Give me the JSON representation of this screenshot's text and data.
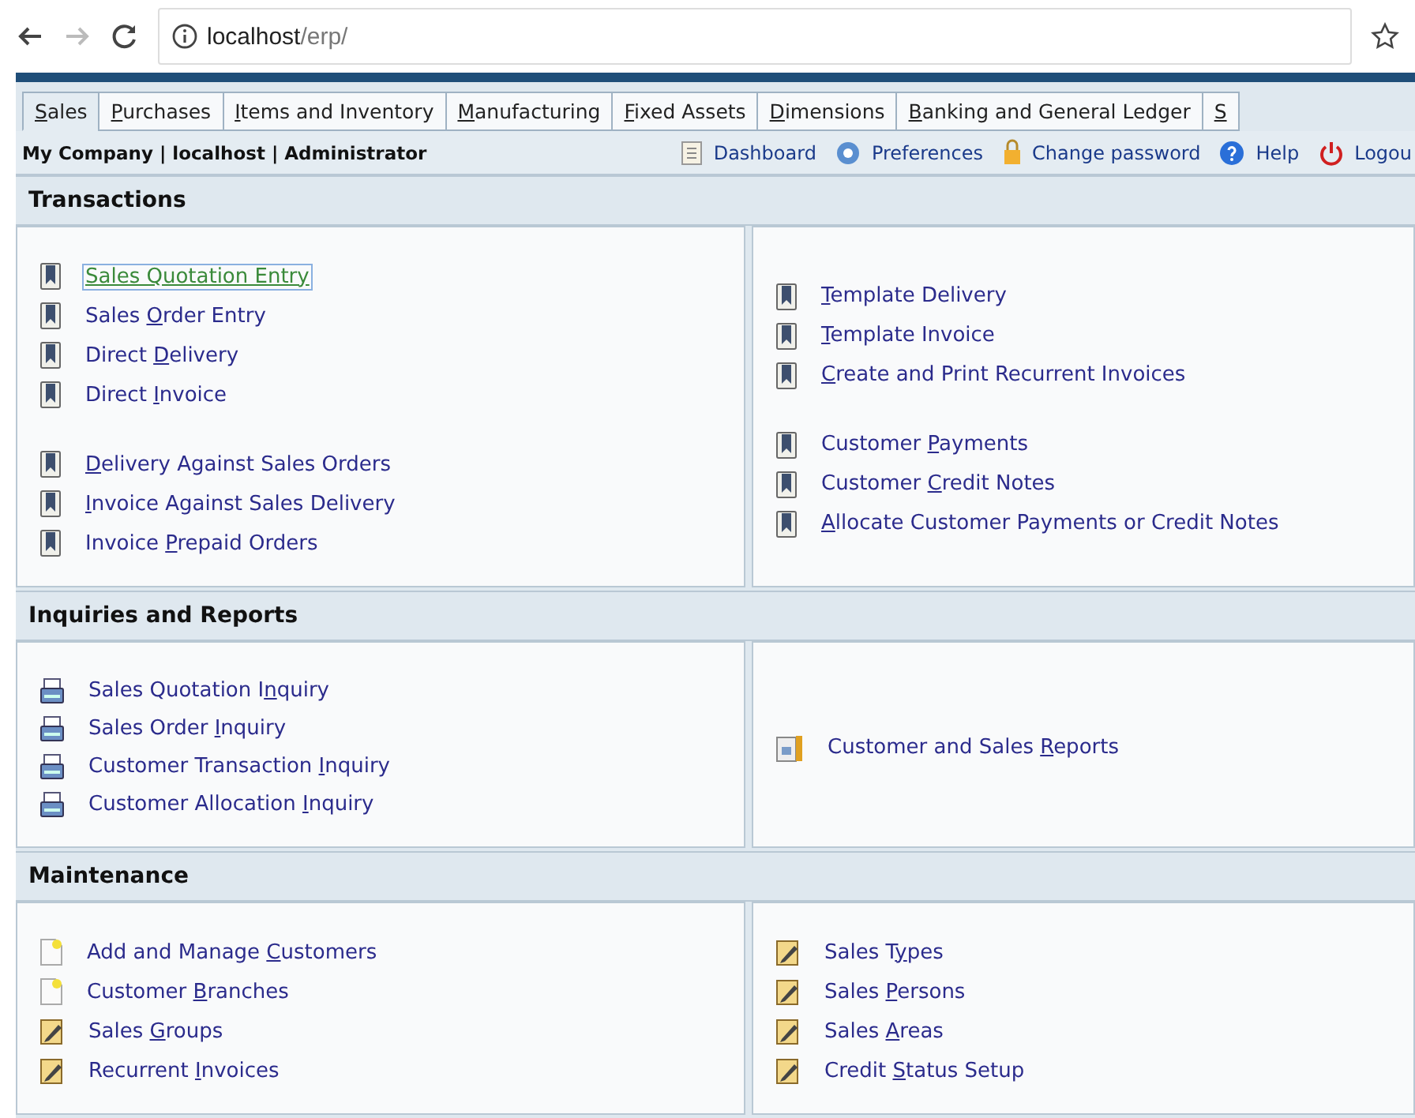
{
  "browser": {
    "url_host": "localhost",
    "url_path": "/erp/"
  },
  "tabs": [
    {
      "label": {
        "key": "S",
        "post": "ales"
      },
      "selected": true
    },
    {
      "label": {
        "key": "P",
        "post": "urchases"
      },
      "selected": false
    },
    {
      "label": {
        "key": "I",
        "post": "tems and Inventory"
      },
      "selected": false
    },
    {
      "label": {
        "key": "M",
        "post": "anufacturing"
      },
      "selected": false
    },
    {
      "label": {
        "key": "F",
        "post": "ixed Assets"
      },
      "selected": false
    },
    {
      "label": {
        "key": "D",
        "post": "imensions"
      },
      "selected": false
    },
    {
      "label": {
        "key": "B",
        "post": "anking and General Ledger"
      },
      "selected": false
    },
    {
      "label": {
        "key": "S"
      },
      "selected": false
    }
  ],
  "user_info": "My Company | localhost | Administrator",
  "toolbar": [
    {
      "kind": "dashboard",
      "label": "Dashboard"
    },
    {
      "kind": "preferences",
      "label": "Preferences"
    },
    {
      "kind": "password",
      "label": "Change password"
    },
    {
      "kind": "help",
      "label": "Help"
    },
    {
      "kind": "logout",
      "label": "Logou"
    }
  ],
  "sections": [
    {
      "title": "Transactions",
      "columns": [
        [
          [
            {
              "kind": "entry",
              "label": {
                "pre": "Sales Quotation Entry"
              },
              "focused": true
            },
            {
              "kind": "entry",
              "label": {
                "pre": "Sales ",
                "key": "O",
                "post": "rder Entry"
              },
              "focused": false
            },
            {
              "kind": "entry",
              "label": {
                "pre": "Direct ",
                "key": "D",
                "post": "elivery"
              },
              "focused": false
            },
            {
              "kind": "entry",
              "label": {
                "pre": "Direct ",
                "key": "I",
                "post": "nvoice"
              },
              "focused": false
            }
          ],
          [
            {
              "kind": "entry",
              "label": {
                "key": "D",
                "post": "elivery Against Sales Orders"
              },
              "focused": false
            },
            {
              "kind": "entry",
              "label": {
                "key": "I",
                "post": "nvoice Against Sales Delivery"
              },
              "focused": false
            },
            {
              "kind": "entry",
              "label": {
                "pre": "Invoice ",
                "key": "P",
                "post": "repaid Orders"
              },
              "focused": false
            }
          ]
        ],
        [
          [
            {
              "kind": "entry",
              "label": {
                "key": "T",
                "post": "emplate Delivery"
              },
              "focused": false
            },
            {
              "kind": "entry",
              "label": {
                "key": "T",
                "post": "emplate Invoice"
              },
              "focused": false
            },
            {
              "kind": "entry",
              "label": {
                "key": "C",
                "post": "reate and Print Recurrent Invoices"
              },
              "focused": false
            }
          ],
          [
            {
              "kind": "entry",
              "label": {
                "pre": "Customer ",
                "key": "P",
                "post": "ayments"
              },
              "focused": false
            },
            {
              "kind": "entry",
              "label": {
                "pre": "Customer ",
                "key": "C",
                "post": "redit Notes"
              },
              "focused": false
            },
            {
              "kind": "entry",
              "label": {
                "key": "A",
                "post": "llocate Customer Payments or Credit Notes"
              },
              "focused": false
            }
          ]
        ]
      ]
    },
    {
      "title": "Inquiries and Reports",
      "columns": [
        [
          [
            {
              "kind": "inquiry",
              "label": {
                "pre": "Sales Quotation I",
                "key": "n",
                "post": "quiry"
              },
              "focused": false
            },
            {
              "kind": "inquiry",
              "label": {
                "pre": "Sales Order ",
                "key": "I",
                "post": "nquiry"
              },
              "focused": false
            },
            {
              "kind": "inquiry",
              "label": {
                "pre": "Customer Transaction ",
                "key": "I",
                "post": "nquiry"
              },
              "focused": false
            },
            {
              "kind": "inquiry",
              "label": {
                "pre": "Customer Allocation ",
                "key": "I",
                "post": "nquiry"
              },
              "focused": false
            }
          ]
        ],
        [
          [
            {
              "kind": "report",
              "label": {
                "pre": "Customer and Sales ",
                "key": "R",
                "post": "eports"
              },
              "focused": false
            }
          ]
        ]
      ]
    },
    {
      "title": "Maintenance",
      "columns": [
        [
          [
            {
              "kind": "new",
              "label": {
                "pre": "Add and Manage ",
                "key": "C",
                "post": "ustomers"
              },
              "focused": false
            },
            {
              "kind": "new",
              "label": {
                "pre": "Customer ",
                "key": "B",
                "post": "ranches"
              },
              "focused": false
            },
            {
              "kind": "edit",
              "label": {
                "pre": "Sales ",
                "key": "G",
                "post": "roups"
              },
              "focused": false
            },
            {
              "kind": "edit",
              "label": {
                "pre": "Recurrent ",
                "key": "I",
                "post": "nvoices"
              },
              "focused": false
            }
          ]
        ],
        [
          [
            {
              "kind": "edit",
              "label": {
                "pre": "Sales T",
                "key": "y",
                "post": "pes"
              },
              "focused": false
            },
            {
              "kind": "edit",
              "label": {
                "pre": "Sales ",
                "key": "P",
                "post": "ersons"
              },
              "focused": false
            },
            {
              "kind": "edit",
              "label": {
                "pre": "Sales ",
                "key": "A",
                "post": "reas"
              },
              "focused": false
            },
            {
              "kind": "edit",
              "label": {
                "pre": "Credit ",
                "key": "S",
                "post": "tatus Setup"
              },
              "focused": false
            }
          ]
        ]
      ]
    }
  ]
}
